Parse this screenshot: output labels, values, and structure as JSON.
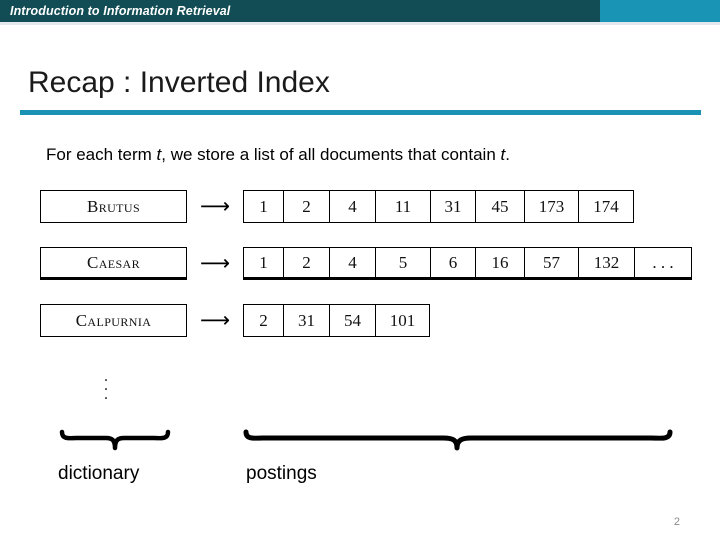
{
  "banner": {
    "title": "Introduction to Information Retrieval",
    "left_color": "#124c54",
    "right_color": "#1a94b5"
  },
  "slide": {
    "title": "Recap : Inverted Index",
    "rule_color": "#1a92b3",
    "lead_text_before": "For each term ",
    "lead_italic_1": "t",
    "lead_text_middle": ", we store a list of all documents that contain ",
    "lead_italic_2": "t",
    "lead_text_after": "."
  },
  "inverted_index": {
    "arrow_glyph": "⟶",
    "rows": [
      {
        "term": "Brutus",
        "postings": [
          "1",
          "2",
          "4",
          "11",
          "31",
          "45",
          "173",
          "174"
        ]
      },
      {
        "term": "Caesar",
        "postings": [
          "1",
          "2",
          "4",
          "5",
          "6",
          "16",
          "57",
          "132",
          ". . ."
        ]
      },
      {
        "term": "Calpurnia",
        "postings": [
          "2",
          "31",
          "54",
          "101"
        ]
      }
    ],
    "vertical_ellipsis": "⋮"
  },
  "braces": {
    "dictionary_label": "dictionary",
    "postings_label": "postings"
  },
  "footer": {
    "page_number": "2"
  }
}
